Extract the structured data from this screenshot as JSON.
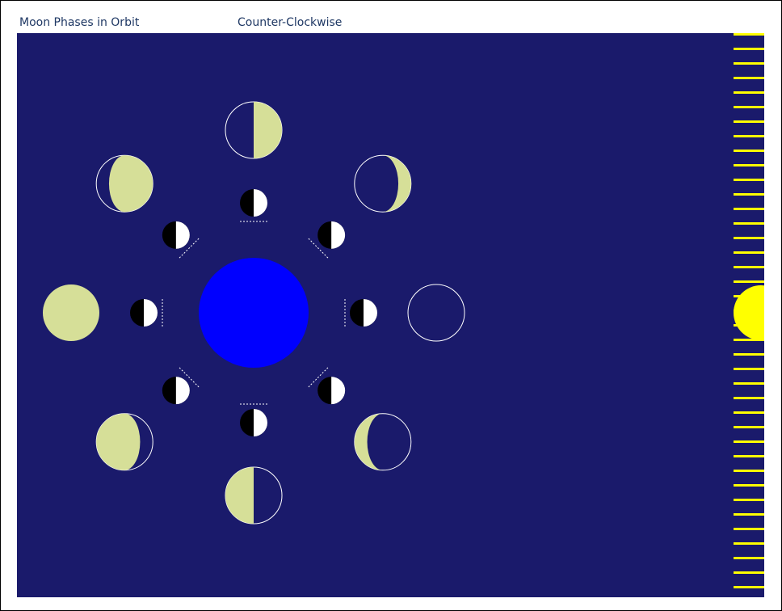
{
  "title": "Moon Phases in Orbit",
  "direction": "Counter-Clockwise",
  "colors": {
    "space": "#1a1a6b",
    "earth": "#0000ff",
    "sun": "#ffff00",
    "sunlight_rays": "#ffff00",
    "moon_lit": "#d6df98",
    "moon_outline": "#ffffff",
    "orbit_moon_lit": "#ffffff",
    "orbit_moon_dark": "#000000"
  },
  "icons": {
    "earth": "earth-icon",
    "sun": "sun-icon",
    "orbit_moon": "orbit-moon-icon",
    "phase_moon": "phase-moon-icon"
  },
  "phases": [
    "new-moon",
    "waxing-crescent",
    "first-quarter",
    "waxing-gibbous",
    "full-moon",
    "waning-gibbous",
    "third-quarter",
    "waning-crescent"
  ]
}
